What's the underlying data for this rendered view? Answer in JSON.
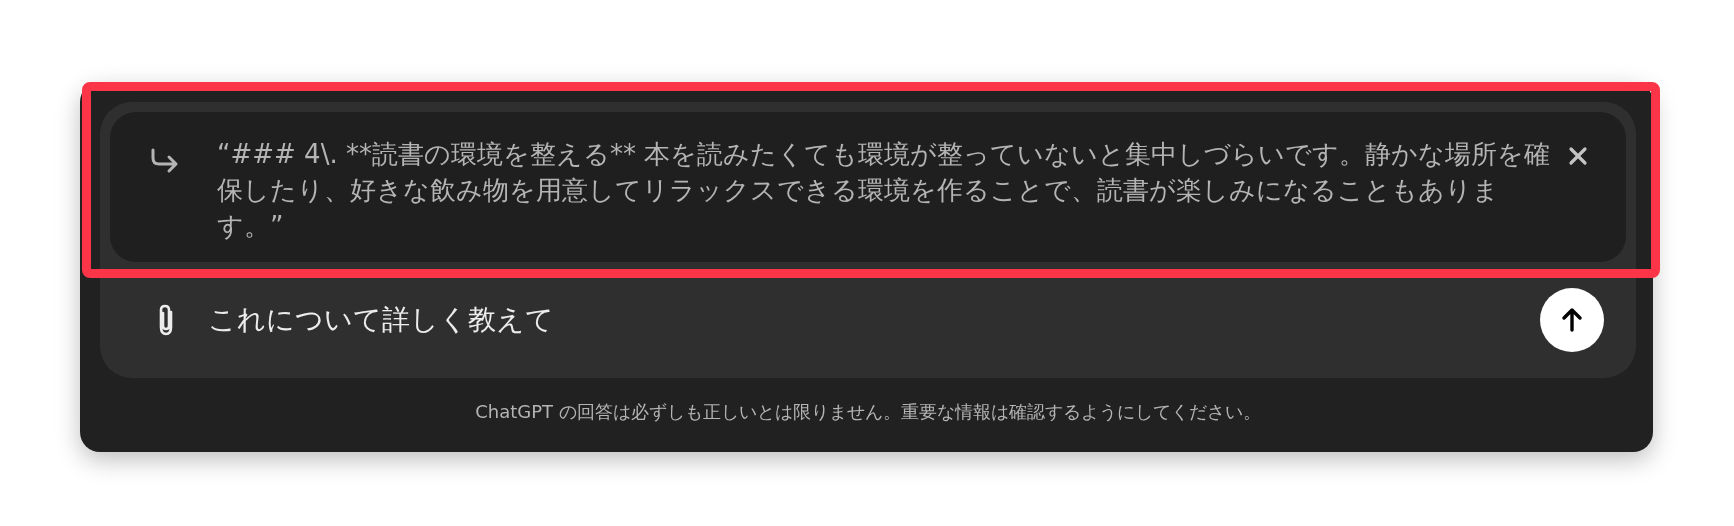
{
  "quote": {
    "text": "“### 4\\. **読書の環境を整える** 本を読みたくても環境が整っていないと集中しづらいです。静かな場所を確保したり、好きな飲み物を用意してリラックスできる環境を作ることで、読書が楽しみになることもあります。”"
  },
  "input": {
    "value": "これについて詳しく教えて"
  },
  "disclaimer": "ChatGPT の回答は必ずしも正しいとは限りません。重要な情報は確認するようにしてください。",
  "highlight_frame": true
}
